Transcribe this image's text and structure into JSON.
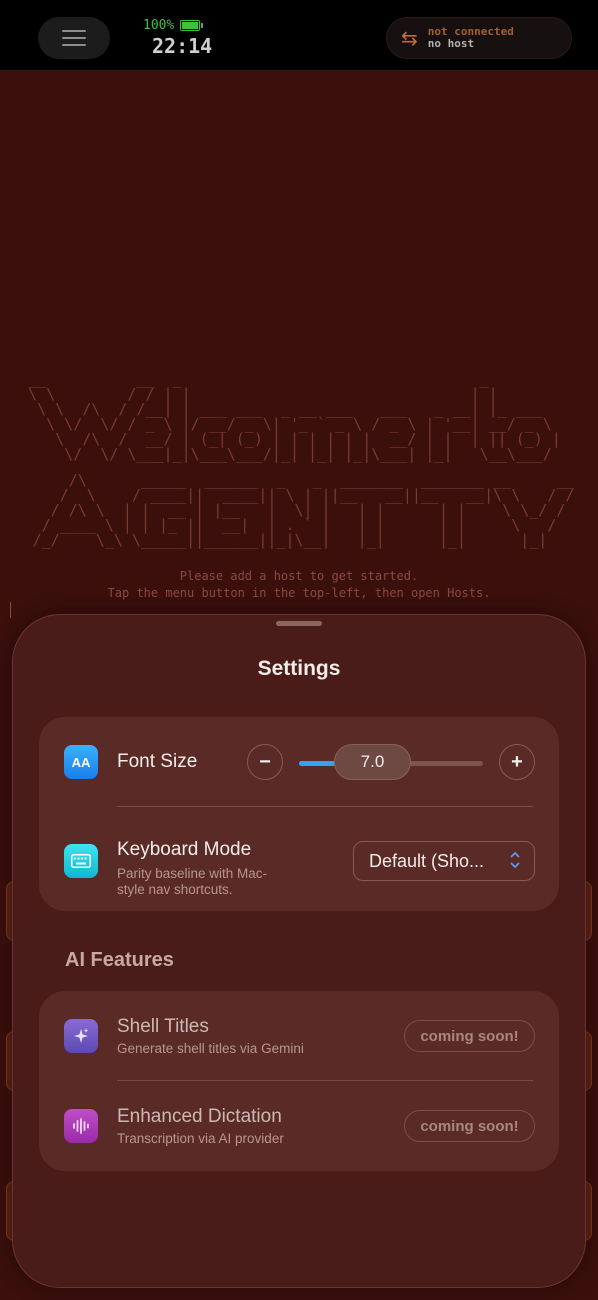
{
  "status": {
    "battery": "100%",
    "time": "22:14"
  },
  "connection": {
    "line1": "not connected",
    "line2": "no host"
  },
  "terminal": {
    "ascii_welcome": " __          __  _                                 _          \n \\ \\        / / | |                               | |         \n  \\ \\  /\\  / /__| | ___ ___  _ __ ___   ___   _ __| |_ ___    \n   \\ \\/  \\/ / _ \\ |/ __/ _ \\| '_ ` _ \\ / _ \\ | '__| __/ _ \\   \n    \\  /\\  /  __/ | (_| (_) | | | | | |  __/ | |  | || (_) |  \n     \\/  \\/ \\___|_|\\___\\___/|_| |_| |_|\\___| |_|   \\__\\___/   ",
    "ascii_agentty": "     /\\      _____  ______  _   _  _______  _______ __     __\n    /  \\    / ____||  ____|| \\ | ||__   __||__   __|\\ \\   / /\n   / /\\ \\  | |  __ | |__   |  \\| |   | |      | |    \\ \\_/ / \n  / ____ \\ | | |_ ||  __|  | . ` |   | |      | |     \\   /  \n /_/    \\_\\ \\_____||______||_|\\__|   |_|      |_|      |_|   ",
    "line1": "Please add a host to get started.",
    "line2": "Tap the menu button in the top-left, then open Hosts."
  },
  "settings": {
    "title": "Settings",
    "font_size": {
      "icon_text": "AA",
      "label": "Font Size",
      "value": "7.0",
      "minus": "−",
      "plus": "+",
      "slider_fraction": 0.2
    },
    "keyboard": {
      "label": "Keyboard Mode",
      "description": "Parity baseline with Mac-\nstyle nav shortcuts.",
      "selected": "Default (Sho..."
    },
    "ai_section": "AI Features",
    "shell_titles": {
      "label": "Shell Titles",
      "description": "Generate shell titles via Gemini",
      "badge": "coming soon!"
    },
    "dictation": {
      "label": "Enhanced Dictation",
      "description": "Transcription via AI provider",
      "badge": "coming soon!"
    }
  },
  "colors": {
    "accent": "#3aa0f0",
    "battery": "#3ec23e",
    "terminal_bg": "#3a0f0c",
    "sheet_bg": "#4a1c19"
  }
}
